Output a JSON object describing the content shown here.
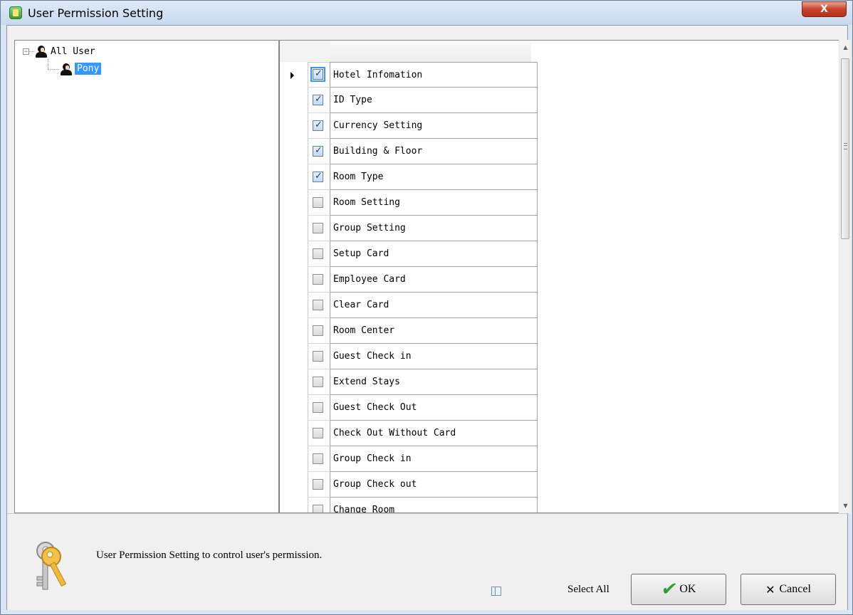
{
  "window": {
    "title": "User Permission Setting",
    "close_glyph": "X"
  },
  "tree": {
    "root": {
      "label": "All User",
      "expander": "−"
    },
    "children": [
      {
        "label": "Pony",
        "selected": true
      }
    ]
  },
  "permissions": [
    {
      "name": "Hotel Infomation",
      "checked": true
    },
    {
      "name": "ID Type",
      "checked": true
    },
    {
      "name": "Currency Setting",
      "checked": true
    },
    {
      "name": "Building & Floor",
      "checked": true
    },
    {
      "name": "Room Type",
      "checked": true
    },
    {
      "name": "Room Setting",
      "checked": false
    },
    {
      "name": "Group Setting",
      "checked": false
    },
    {
      "name": "Setup Card",
      "checked": false
    },
    {
      "name": "Employee Card",
      "checked": false
    },
    {
      "name": "Clear Card",
      "checked": false
    },
    {
      "name": "Room Center",
      "checked": false
    },
    {
      "name": "Guest Check in",
      "checked": false
    },
    {
      "name": "Extend Stays",
      "checked": false
    },
    {
      "name": "Guest Check Out",
      "checked": false
    },
    {
      "name": "Check Out Without Card",
      "checked": false
    },
    {
      "name": "Group Check in",
      "checked": false
    },
    {
      "name": "Group Check out",
      "checked": false
    },
    {
      "name": "Change Room",
      "checked": false
    }
  ],
  "footer": {
    "description": "User Permission Setting to control user's permission.",
    "select_all_label": "Select All",
    "ok_label": "OK",
    "cancel_label": "Cancel"
  },
  "icons": {
    "title": "app-icon",
    "tree_user": "user-icon",
    "footer": "keys-icon",
    "ok": "checkmark-icon",
    "cancel": "x-icon",
    "layout": "layout-icon"
  },
  "colors": {
    "selection": "#3399ff",
    "close_button": "#c7432b",
    "ok_check": "#2f9e2f"
  }
}
